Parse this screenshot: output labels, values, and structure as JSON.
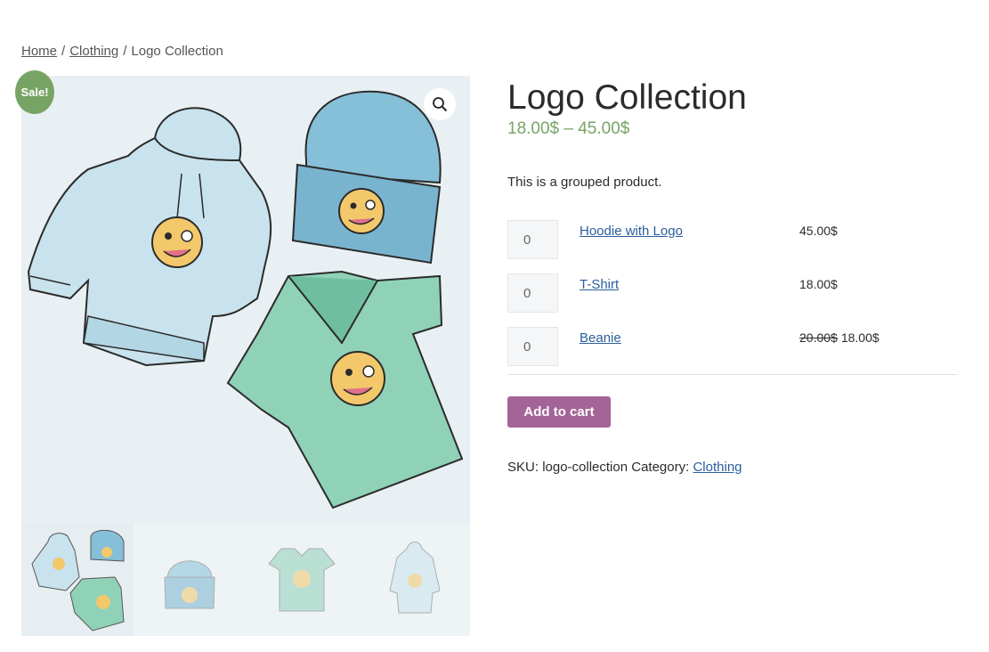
{
  "breadcrumb": {
    "home": "Home",
    "clothing": "Clothing",
    "separator": "/",
    "current": "Logo Collection"
  },
  "badge": {
    "sale": "Sale!"
  },
  "product": {
    "title": "Logo Collection",
    "price_range": "18.00$ – 45.00$",
    "description": "This is a grouped product."
  },
  "grouped_items": [
    {
      "qty": "0",
      "name": "Hoodie with Logo",
      "price": "45.00$",
      "old_price": ""
    },
    {
      "qty": "0",
      "name": "T-Shirt",
      "price": "18.00$",
      "old_price": ""
    },
    {
      "qty": "0",
      "name": "Beanie",
      "price": "18.00$",
      "old_price": "20.00$"
    }
  ],
  "cart": {
    "button_label": "Add to cart"
  },
  "meta": {
    "sku_label": "SKU:",
    "sku": "logo-collection",
    "category_label": "Category:",
    "category": "Clothing"
  },
  "icons": {
    "zoom": "magnifier-icon"
  },
  "colors": {
    "accent_green": "#77a464",
    "button_purple": "#a46497",
    "link_blue": "#2a5e9c"
  }
}
